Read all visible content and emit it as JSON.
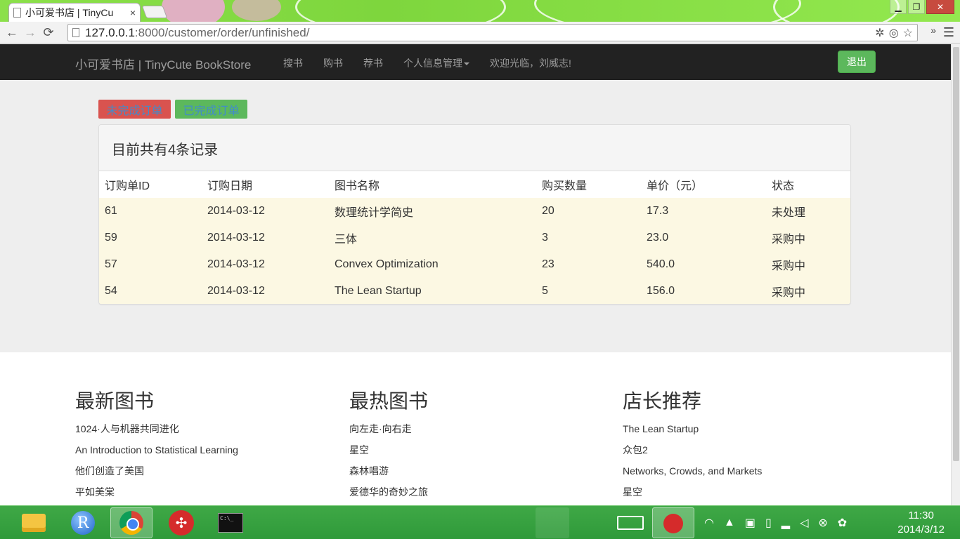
{
  "browser": {
    "tab_title": "小可爱书店 | TinyCu",
    "tab_close": "×",
    "url_host": "127.0.0.1",
    "url_path": ":8000/customer/order/unfinished/",
    "window_buttons": [
      "▁",
      "❐",
      "✕"
    ],
    "icons": [
      "page-icon",
      "back-icon",
      "forward-icon",
      "reload-icon",
      "star-icon",
      "menu-icon"
    ]
  },
  "navbar": {
    "brand": "小可爱书店 | TinyCute BookStore",
    "links": [
      "搜书",
      "购书",
      "荐书",
      "个人信息管理"
    ],
    "welcome": "欢迎光临，刘威志!",
    "logout": "退出"
  },
  "tabs": {
    "unfinished": "未完成订单",
    "finished": "已完成订单"
  },
  "colors": {
    "navbar_bg": "#222222",
    "unfinished_btn": "#d9534f",
    "finished_btn": "#5cb85c",
    "row_bg": "#fcf8e3"
  },
  "orders": {
    "summary": "目前共有4条记录",
    "columns": [
      "订购单ID",
      "订购日期",
      "图书名称",
      "购买数量",
      "单价（元）",
      "状态"
    ],
    "rows": [
      [
        "61",
        "2014-03-12",
        "数理统计学简史",
        "20",
        "17.3",
        "未处理"
      ],
      [
        "59",
        "2014-03-12",
        "三体",
        "3",
        "23.0",
        "采购中"
      ],
      [
        "57",
        "2014-03-12",
        "Convex Optimization",
        "23",
        "540.0",
        "采购中"
      ],
      [
        "54",
        "2014-03-12",
        "The Lean Startup",
        "5",
        "156.0",
        "采购中"
      ]
    ]
  },
  "footer": {
    "newest": {
      "title": "最新图书",
      "items": [
        "1024·人与机器共同进化",
        "An Introduction to Statistical Learning",
        "他们创造了美国",
        "平如美棠"
      ]
    },
    "hottest": {
      "title": "最热图书",
      "items": [
        "向左走·向右走",
        "星空",
        "森林唱游",
        "爱德华的奇妙之旅"
      ]
    },
    "recommended": {
      "title": "店长推荐",
      "items": [
        "The Lean Startup",
        "众包2",
        "Networks, Crowds, and Markets",
        "星空"
      ]
    }
  },
  "taskbar": {
    "time": "11:30",
    "date": "2014/3/12",
    "apps": [
      "file-explorer-icon",
      "r-icon",
      "chrome-icon",
      "app-red-icon",
      "cmd-icon"
    ]
  }
}
